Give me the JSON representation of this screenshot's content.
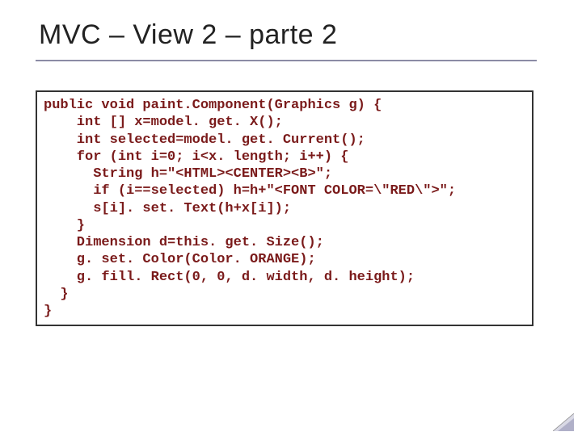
{
  "title": "MVC –  View 2 – parte 2",
  "code": {
    "lines": [
      "public void paint.Component(Graphics g) {",
      "    int [] x=model. get. X();",
      "    int selected=model. get. Current();",
      "    for (int i=0; i<x. length; i++) {",
      "      String h=\"<HTML><CENTER><B>\";",
      "      if (i==selected) h=h+\"<FONT COLOR=\\\"RED\\\">\";",
      "      s[i]. set. Text(h+x[i]);",
      "    }",
      "    Dimension d=this. get. Size();",
      "    g. set. Color(Color. ORANGE);",
      "    g. fill. Rect(0, 0, d. width, d. height);",
      "  }",
      "}"
    ]
  }
}
